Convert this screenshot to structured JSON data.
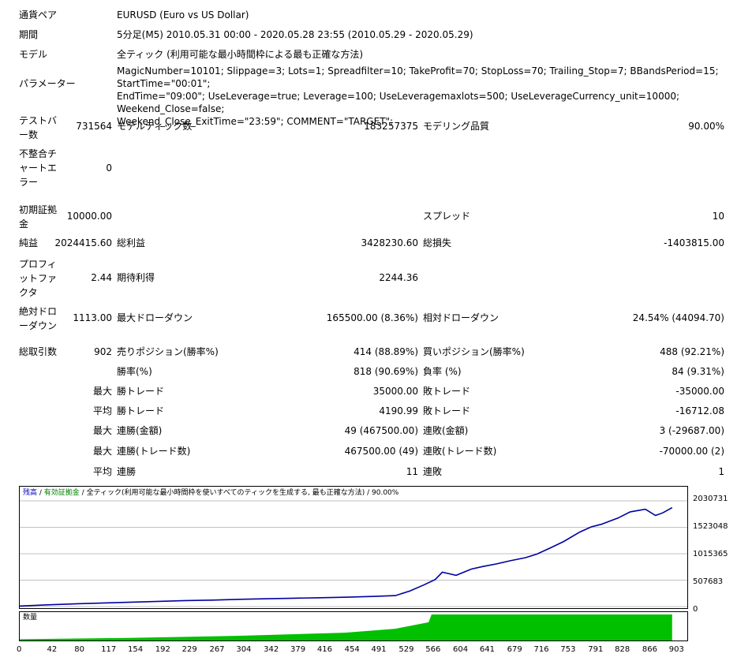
{
  "report": {
    "currency_pair": {
      "label": "通貨ペア",
      "value": "EURUSD (Euro vs US Dollar)"
    },
    "period": {
      "label": "期間",
      "value": "5分足(M5) 2010.05.31 00:00 - 2020.05.28 23:55 (2010.05.29 - 2020.05.29)"
    },
    "model": {
      "label": "モデル",
      "value": "全ティック (利用可能な最小時間枠による最も正確な方法)"
    },
    "parameters": {
      "label": "パラメーター",
      "lines": [
        "MagicNumber=10101; Slippage=3; Lots=1; Spreadfilter=10; TakeProfit=70; StopLoss=70; Trailing_Stop=7; BBandsPeriod=15; StartTime=\"00:01\";",
        "EndTime=\"09:00\"; UseLeverage=true; Leverage=100; UseLeveragemaxlots=500; UseLeverageCurrency_unit=10000; Weekend_Close=false;",
        "Weekend_Close_ExitTime=\"23:59\"; COMMENT=\"TARGET\";"
      ]
    },
    "bars_in_test": {
      "label_lines": [
        "テストバ",
        "ー数"
      ],
      "value": "731564"
    },
    "model_ticks": {
      "label": "モデルティック数",
      "value": "183257375"
    },
    "modeling_quality": {
      "label": "モデリング品質",
      "value": "90.00%"
    },
    "mismatched_errors": {
      "label_lines": [
        "不整合チ",
        "ャートエ",
        "ラー"
      ],
      "value": "0"
    },
    "initial_deposit": {
      "label_lines": [
        "初期証拠",
        "金"
      ],
      "value": "10000.00"
    },
    "spread": {
      "label": "スプレッド",
      "value": "10"
    },
    "net_profit": {
      "label": "純益",
      "value": "2024415.60"
    },
    "gross_profit": {
      "label": "総利益",
      "value": "3428230.60"
    },
    "gross_loss": {
      "label": "総損失",
      "value": "-1403815.00"
    },
    "profit_factor": {
      "label_lines": [
        "プロフィ",
        "ットファ",
        "クタ"
      ],
      "value": "2.44"
    },
    "expected_payoff": {
      "label": "期待利得",
      "value": "2244.36"
    },
    "absolute_drawdown": {
      "label_lines": [
        "絶対ドロ",
        "ーダウン"
      ],
      "value": "1113.00"
    },
    "maximal_drawdown": {
      "label": "最大ドローダウン",
      "value": "165500.00 (8.36%)"
    },
    "relative_drawdown": {
      "label": "相対ドローダウン",
      "value": "24.54% (44094.70)"
    },
    "total_trades": {
      "label": "総取引数",
      "value": "902"
    },
    "short_positions": {
      "label": "売りポジション(勝率%)",
      "value": "414 (88.89%)"
    },
    "long_positions": {
      "label": "買いポジション(勝率%)",
      "value": "488 (92.21%)"
    },
    "profit_trades": {
      "label": "勝率(%)",
      "value": "818 (90.69%)"
    },
    "loss_trades": {
      "label": "負率 (%)",
      "value": "84 (9.31%)"
    },
    "largest": {
      "prefix": "最大",
      "win_label": "勝トレード",
      "win_value": "35000.00",
      "loss_label": "敗トレード",
      "loss_value": "-35000.00"
    },
    "average": {
      "prefix": "平均",
      "win_label": "勝トレード",
      "win_value": "4190.99",
      "loss_label": "敗トレード",
      "loss_value": "-16712.08"
    },
    "max_consecutive": {
      "prefix": "最大",
      "win_label": "連勝(金額)",
      "win_value": "49 (467500.00)",
      "loss_label": "連敗(金額)",
      "loss_value": "3 (-29687.00)"
    },
    "max_consecutive_trades": {
      "prefix": "最大",
      "win_label": "連勝(トレード数)",
      "win_value": "467500.00 (49)",
      "loss_label": "連敗(トレード数)",
      "loss_value": "-70000.00 (2)"
    },
    "average_consecutive": {
      "prefix": "平均",
      "win_label": "連勝",
      "win_value": "11",
      "loss_label": "連敗",
      "loss_value": "1"
    }
  },
  "graph": {
    "legend": {
      "balance": "残高",
      "sep1": " / ",
      "equity": "有効証拠金",
      "sep2": " / ",
      "model": "全ティック(利用可能な最小時間枠を使いすべてのティックを生成する, 最も正確な方法)",
      "sep3": " / ",
      "quality": "90.00%"
    },
    "volume_label": "数量",
    "colors": {
      "balance": "#0000a0",
      "volume": "#00c000",
      "grid": "#c0c0c0"
    }
  },
  "chart_data": {
    "type": "line",
    "ylim": [
      0,
      2030731
    ],
    "y_ticks": [
      "2030731",
      "1523048",
      "1015365",
      "507683",
      "0"
    ],
    "x_ticks": [
      "0",
      "42",
      "80",
      "117",
      "154",
      "192",
      "229",
      "267",
      "304",
      "342",
      "379",
      "416",
      "454",
      "491",
      "529",
      "566",
      "604",
      "641",
      "679",
      "716",
      "753",
      "791",
      "828",
      "866",
      "903"
    ],
    "grid": true,
    "series": [
      {
        "x": [
          0,
          42,
          80,
          117,
          154,
          192,
          229,
          267,
          304,
          342,
          379,
          416,
          454,
          491,
          520,
          540,
          560,
          575,
          585,
          604,
          625,
          641,
          660,
          679,
          700,
          716,
          735,
          753,
          775,
          791,
          805,
          820,
          828,
          845,
          866,
          880,
          890,
          903
        ],
        "y": [
          10000,
          35000,
          55000,
          70000,
          85000,
          100000,
          115000,
          125000,
          140000,
          150000,
          160000,
          170000,
          180000,
          195000,
          210000,
          300000,
          420000,
          520000,
          660000,
          600000,
          720000,
          770000,
          820000,
          880000,
          940000,
          1010000,
          1130000,
          1250000,
          1430000,
          1530000,
          1580000,
          1660000,
          1700000,
          1820000,
          1870000,
          1750000,
          1800000,
          1900000
        ]
      }
    ],
    "volume": {
      "x": [
        0,
        150,
        300,
        450,
        520,
        566,
        570,
        903
      ],
      "y": [
        0.05,
        0.1,
        0.18,
        0.3,
        0.45,
        0.7,
        1.0,
        1.0
      ]
    }
  }
}
